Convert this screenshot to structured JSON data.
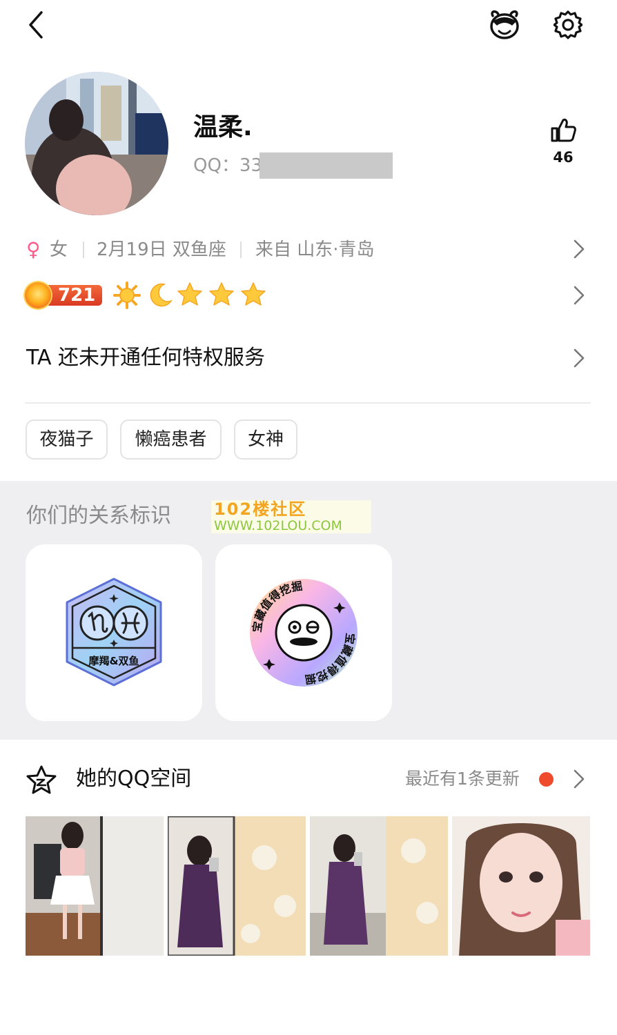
{
  "header": {
    "back_icon": "back-arrow-icon",
    "pet_icon": "pet-face-icon",
    "settings_icon": "gear-icon"
  },
  "profile": {
    "nickname": "温柔.",
    "qq_label": "QQ：33",
    "like_count": "46",
    "like_icon": "thumbs-up-icon"
  },
  "info": {
    "gender_symbol": "♀",
    "gender": "女",
    "birthday": "2月19日 双鱼座",
    "location": "来自 山东·青岛"
  },
  "level": {
    "value": "721",
    "icons": [
      "sun-icon",
      "moon-icon",
      "star-icon",
      "star-icon",
      "star-icon"
    ]
  },
  "privilege": {
    "text": "TA 还未开通任何特权服务"
  },
  "tags": [
    "夜猫子",
    "懒癌患者",
    "女神"
  ],
  "relationship": {
    "title": "你们的关系标识",
    "watermark_line1": "102楼社区",
    "watermark_line2": "WWW.102LOU.COM",
    "badge1_label": "摩羯&双鱼",
    "badge2_text": "宝藏值得挖掘"
  },
  "qzone": {
    "title": "她的QQ空间",
    "update_text": "最近有1条更新",
    "star_icon": "qzone-star-icon",
    "dot_color": "#f04a2c"
  },
  "colors": {
    "accent_red": "#f04a2c",
    "section_bg": "#efeff2",
    "level_badge": "#e8472b"
  }
}
